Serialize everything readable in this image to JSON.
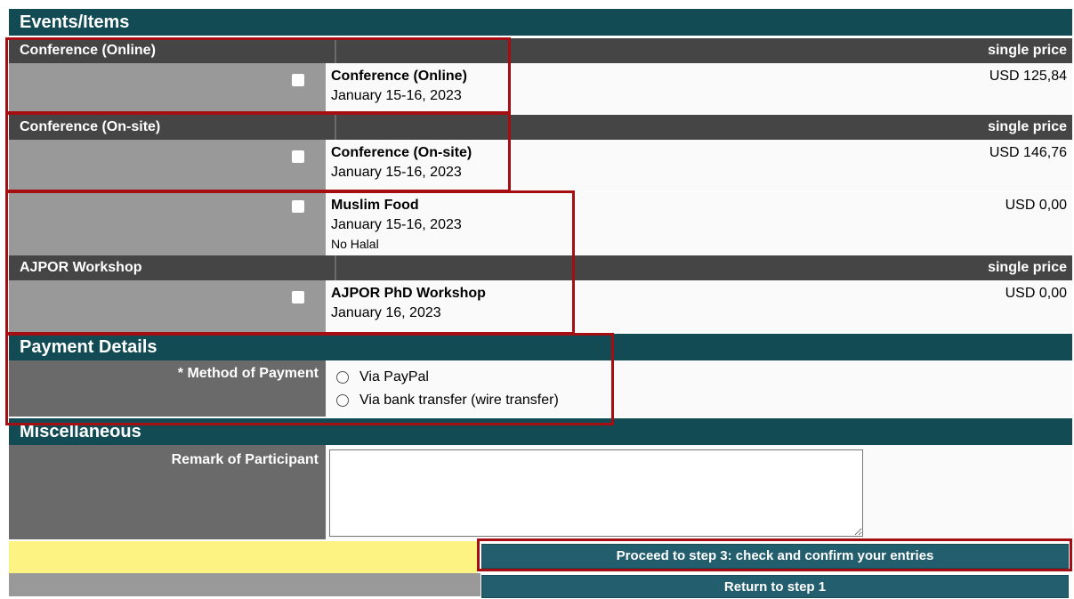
{
  "events": {
    "section_title": "Events/Items",
    "price_header": "single price",
    "groups": [
      {
        "name": "Conference (Online)",
        "items": [
          {
            "title": "Conference (Online)",
            "date": "January 15-16, 2023",
            "price": "USD 125,84"
          }
        ]
      },
      {
        "name": "Conference (On-site)",
        "items": [
          {
            "title": "Conference (On-site)",
            "date": "January 15-16, 2023",
            "price": "USD 146,76"
          },
          {
            "title": "Muslim Food",
            "date": "January 15-16, 2023",
            "note": "No Halal",
            "price": "USD 0,00"
          }
        ]
      },
      {
        "name": "AJPOR Workshop",
        "items": [
          {
            "title": "AJPOR PhD Workshop",
            "date": "January 16, 2023",
            "price": "USD 0,00"
          }
        ]
      }
    ]
  },
  "payment": {
    "section_title": "Payment Details",
    "method_label": "* Method of Payment",
    "options": [
      "Via PayPal",
      "Via bank transfer (wire transfer)"
    ]
  },
  "misc": {
    "section_title": "Miscellaneous",
    "remark_label": "Remark of Participant",
    "remark_value": ""
  },
  "buttons": {
    "proceed": "Proceed to step 3: check and confirm your entries",
    "return": "Return to step 1"
  },
  "colors": {
    "section_header": "#134b54",
    "group_header": "#454545",
    "label_cell": "#999999",
    "highlight_box": "#a50f14",
    "button": "#225e6d",
    "yellow_row": "#fcf382"
  }
}
